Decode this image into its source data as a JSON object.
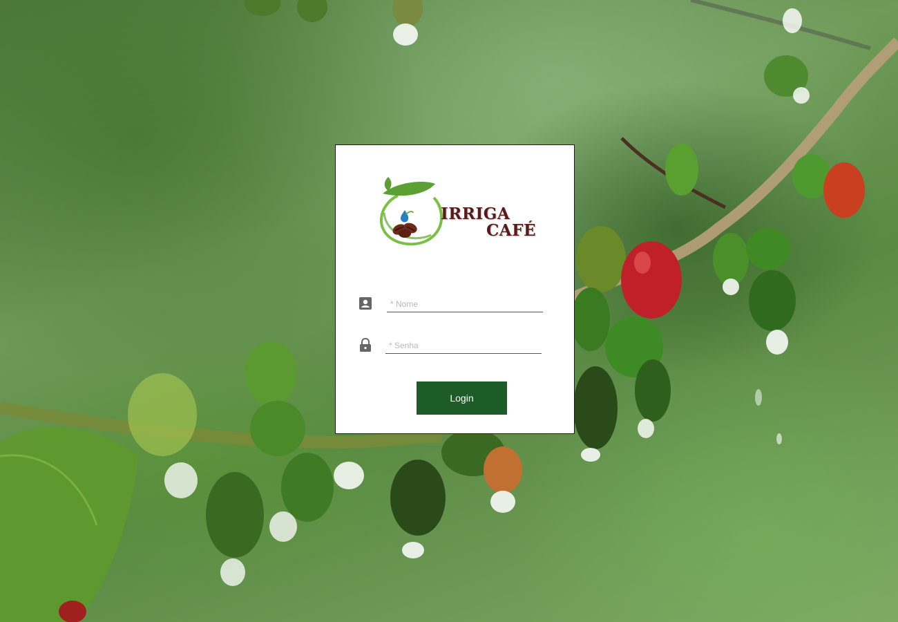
{
  "brand": {
    "line1": "IRRIGA",
    "line2": "CAFÉ",
    "colors": {
      "text": "#5b1a1a",
      "leaf": "#6db33f",
      "water": "#2a7fc1",
      "beans": "#6b2a1a"
    }
  },
  "form": {
    "name_placeholder": "* Nome",
    "password_placeholder": "* Senha",
    "name_icon": "user-card-icon",
    "password_icon": "lock-icon",
    "submit_label": "Login"
  },
  "colors": {
    "button": "#1e5c27",
    "card": "#ffffff"
  }
}
